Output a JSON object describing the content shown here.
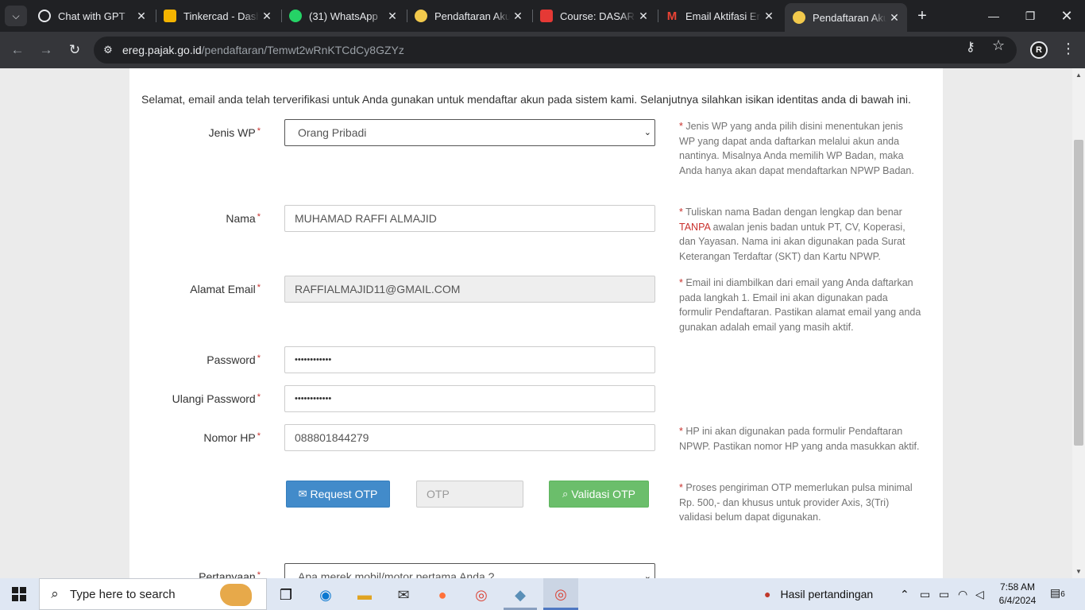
{
  "tabs": [
    {
      "title": "Chat with GPT",
      "icon": "chatgpt-icon",
      "color": "#ffffff"
    },
    {
      "title": "Tinkercad - Dashboard",
      "icon": "tinkercad-icon",
      "color": "#f4b400"
    },
    {
      "title": "(31) WhatsApp",
      "icon": "whatsapp-icon",
      "color": "#25d366"
    },
    {
      "title": "Pendaftaran Akun",
      "icon": "djp-icon",
      "color": "#f2c94c"
    },
    {
      "title": "Course: DASAR PAJAK",
      "icon": "course-icon",
      "color": "#e53935"
    },
    {
      "title": "Email Aktifasi Ereg",
      "icon": "gmail-icon",
      "color": "#ea4335"
    },
    {
      "title": "Pendaftaran Akun",
      "icon": "djp-icon",
      "color": "#f2c94c"
    }
  ],
  "url": {
    "host": "ereg.pajak.go.id",
    "path": "/pendaftaran/Temwt2wRnKTCdCy8GZYz"
  },
  "profile_initial": "R",
  "intro": "Selamat, email anda telah terverifikasi untuk Anda gunakan untuk mendaftar akun pada sistem kami. Selanjutnya silahkan isikan identitas anda di bawah ini.",
  "form": {
    "jenis_wp": {
      "label": "Jenis WP",
      "value": "Orang Pribadi",
      "help": "Jenis WP yang anda pilih disini menentukan jenis WP yang dapat anda daftarkan melalui akun anda nantinya. Misalnya Anda memilih WP Badan, maka Anda hanya akan dapat mendaftarkan NPWP Badan."
    },
    "nama": {
      "label": "Nama",
      "value": "MUHAMAD RAFFI ALMAJID",
      "help_pre": "Tuliskan nama Badan dengan lengkap dan benar ",
      "help_red": "TANPA",
      "help_post": " awalan jenis badan untuk PT, CV, Koperasi, dan Yayasan. Nama ini akan digunakan pada Surat Keterangan Terdaftar (SKT) dan Kartu NPWP."
    },
    "email": {
      "label": "Alamat Email",
      "value": "RAFFIALMAJID11@GMAIL.COM",
      "help": "Email ini diambilkan dari email yang Anda daftarkan pada langkah 1. Email ini akan digunakan pada formulir Pendaftaran. Pastikan alamat email yang anda gunakan adalah email yang masih aktif."
    },
    "password": {
      "label": "Password",
      "value": "••••••••••••"
    },
    "ulangi_password": {
      "label": "Ulangi Password",
      "value": "••••••••••••"
    },
    "nomor_hp": {
      "label": "Nomor HP",
      "value": "088801844279",
      "help": "HP ini akan digunakan pada formulir Pendaftaran NPWP. Pastikan nomor HP yang anda masukkan aktif."
    },
    "otp": {
      "request_label": "Request OTP",
      "placeholder": "OTP",
      "validate_label": "Validasi OTP",
      "help": "Proses pengiriman OTP memerlukan pulsa minimal Rp. 500,- dan khusus untuk provider Axis, 3(Tri) validasi belum dapat digunakan."
    },
    "pertanyaan": {
      "label": "Pertanyaan",
      "value": "Apa merek mobil/motor pertama Anda ?"
    }
  },
  "required_mark": "*",
  "taskbar": {
    "search_placeholder": "Type here to search",
    "weather_text": "Hasil pertandingan",
    "time": "7:58 AM",
    "date": "6/4/2024",
    "notification_count": "6"
  },
  "colors": {
    "accent_blue": "#428bca",
    "success_green": "#5cb85c",
    "required_red": "#c9302c"
  }
}
